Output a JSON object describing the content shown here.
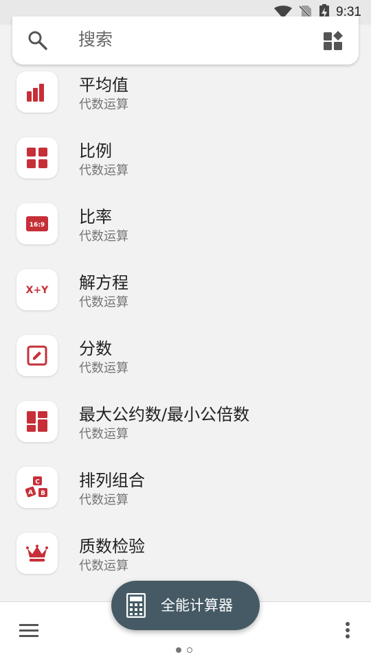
{
  "status_bar": {
    "time": "9:31"
  },
  "search": {
    "placeholder": "搜索"
  },
  "items": [
    {
      "title": "平均值",
      "subtitle": "代数运算",
      "icon": "bar-chart-icon"
    },
    {
      "title": "比例",
      "subtitle": "代数运算",
      "icon": "four-squares-icon"
    },
    {
      "title": "比率",
      "subtitle": "代数运算",
      "icon": "aspect-ratio-icon",
      "icon_text": "16:9"
    },
    {
      "title": "解方程",
      "subtitle": "代数运算",
      "icon": "equation-icon",
      "icon_text": "X+Y"
    },
    {
      "title": "分数",
      "subtitle": "代数运算",
      "icon": "edit-box-icon"
    },
    {
      "title": "最大公约数/最小公倍数",
      "subtitle": "代数运算",
      "icon": "dashboard-icon"
    },
    {
      "title": "排列组合",
      "subtitle": "代数运算",
      "icon": "abc-blocks-icon",
      "icon_text": [
        "C",
        "A",
        "B"
      ]
    },
    {
      "title": "质数检验",
      "subtitle": "代数运算",
      "icon": "crown-icon"
    }
  ],
  "fab": {
    "label": "全能计算器",
    "icon": "calculator-icon"
  },
  "colors": {
    "accent_red": "#c62f38",
    "fab_bg": "#455a64",
    "background": "#f2f2f2"
  }
}
